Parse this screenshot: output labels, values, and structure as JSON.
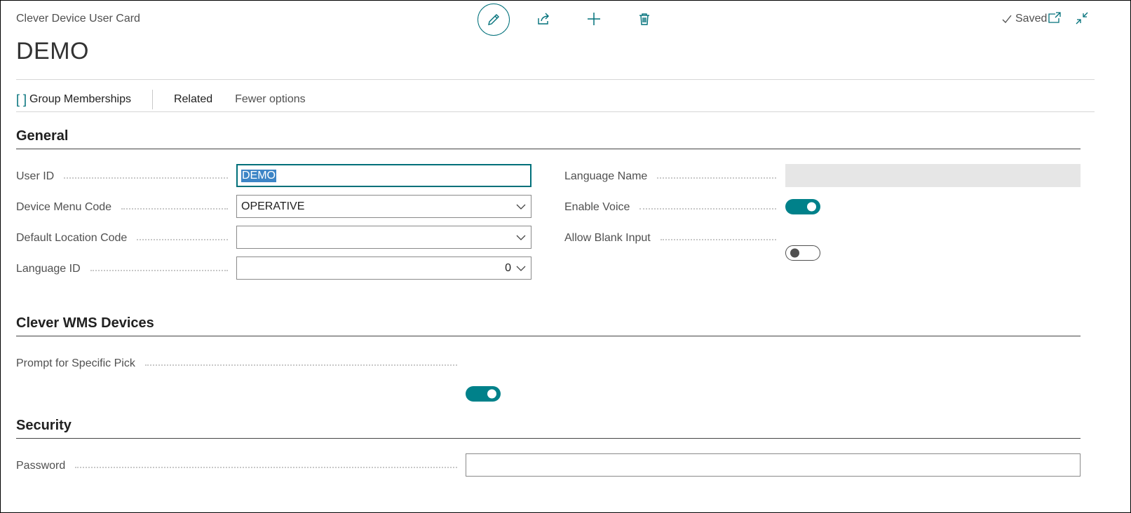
{
  "header": {
    "card_title": "Clever Device User Card",
    "record_title": "DEMO",
    "status": "Saved",
    "icons": [
      "edit-icon",
      "share-icon",
      "add-icon",
      "delete-icon",
      "open-new-window-icon",
      "collapse-icon"
    ]
  },
  "actionbar": {
    "group_memberships": "Group Memberships",
    "group_icon": "[ ]",
    "related": "Related",
    "fewer_options": "Fewer options"
  },
  "general": {
    "title": "General",
    "user_id": {
      "label": "User ID",
      "value": "DEMO"
    },
    "device_menu_code": {
      "label": "Device Menu Code",
      "value": "OPERATIVE"
    },
    "default_location_code": {
      "label": "Default Location Code",
      "value": ""
    },
    "language_id": {
      "label": "Language ID",
      "value": "0"
    },
    "language_name": {
      "label": "Language Name",
      "value": ""
    },
    "enable_voice": {
      "label": "Enable Voice",
      "value": true
    },
    "allow_blank_input": {
      "label": "Allow Blank Input",
      "value": false
    }
  },
  "wms_devices": {
    "title": "Clever WMS Devices",
    "prompt_specific_pick": {
      "label": "Prompt for Specific Pick",
      "value": true
    }
  },
  "security": {
    "title": "Security",
    "password": {
      "label": "Password",
      "value": ""
    }
  },
  "colors": {
    "accent": "#00707a",
    "toggle_on": "#00818a",
    "selection": "#3d85c6"
  }
}
